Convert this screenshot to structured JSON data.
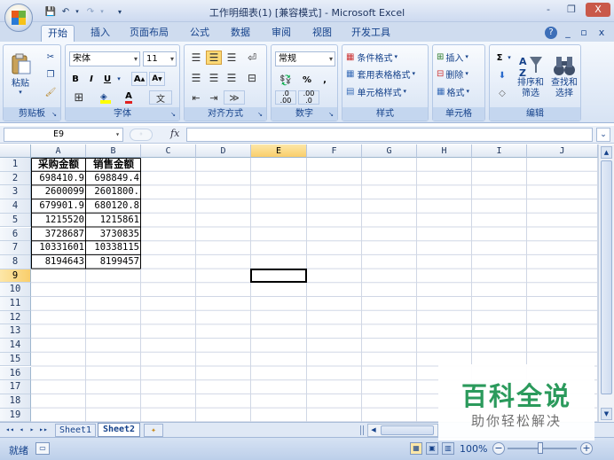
{
  "window": {
    "title": "工作明细表(1)  [兼容模式] - Microsoft Excel",
    "controls": [
      "-",
      "❐",
      "X"
    ]
  },
  "quick_access": {
    "save": "💾",
    "undo": "↶",
    "redo": "↷"
  },
  "tabs": [
    "开始",
    "插入",
    "页面布局",
    "公式",
    "数据",
    "审阅",
    "视图",
    "开发工具"
  ],
  "active_tab": "开始",
  "ribbon_right": {
    "help": "?",
    "min": "_",
    "restore": "▫",
    "close": "x"
  },
  "ribbon": {
    "clipboard": {
      "label": "剪贴板",
      "paste": "粘贴"
    },
    "font": {
      "label": "字体",
      "font_name": "宋体",
      "font_size": "11",
      "bold": "B",
      "italic": "I",
      "underline": "U",
      "grow": "A",
      "shrink": "A",
      "font_color": "A",
      "phonetic": "文"
    },
    "alignment": {
      "label": "对齐方式"
    },
    "number": {
      "label": "数字",
      "format": "常规",
      "percent": "%",
      "comma": ",",
      "inc_decimal": ".0\n.00",
      "dec_decimal": ".00\n.0"
    },
    "styles": {
      "label": "样式",
      "conditional": "条件格式",
      "table": "套用表格格式",
      "cell": "单元格样式"
    },
    "cells": {
      "label": "单元格",
      "insert": "插入",
      "delete": "删除",
      "format": "格式"
    },
    "editing": {
      "label": "编辑",
      "sum": "Σ",
      "sort": "排序和\n筛选",
      "find": "查找和\n选择"
    }
  },
  "formula_bar": {
    "name_box": "E9",
    "fx": "fx",
    "formula": ""
  },
  "columns": [
    "A",
    "B",
    "C",
    "D",
    "E",
    "F",
    "G",
    "H",
    "I",
    "J"
  ],
  "selected_column": "E",
  "rows": [
    "1",
    "2",
    "3",
    "4",
    "5",
    "6",
    "7",
    "8",
    "9",
    "10",
    "11",
    "12",
    "13",
    "14",
    "15",
    "16",
    "17",
    "18",
    "19"
  ],
  "selected_row": "9",
  "table": {
    "headers": [
      "采购金额",
      "销售金额"
    ],
    "rows": [
      [
        "698410.9",
        "698849.4"
      ],
      [
        "2600099",
        "2601800."
      ],
      [
        "679901.9",
        "680120.8"
      ],
      [
        "1215520",
        "1215861"
      ],
      [
        "3728687",
        "3730835"
      ],
      [
        "10331601",
        "10338115"
      ],
      [
        "8194643",
        "8199457"
      ]
    ]
  },
  "sheet_nav": [
    "◂◂",
    "◂",
    "▸",
    "▸▸"
  ],
  "sheets": [
    "Sheet1",
    "Sheet2"
  ],
  "active_sheet": "Sheet2",
  "status": {
    "ready": "就绪",
    "zoom": "100%",
    "zoom_out": "−",
    "zoom_in": "+"
  },
  "watermark": {
    "title": "百科全说",
    "subtitle": "助你轻松解决"
  }
}
